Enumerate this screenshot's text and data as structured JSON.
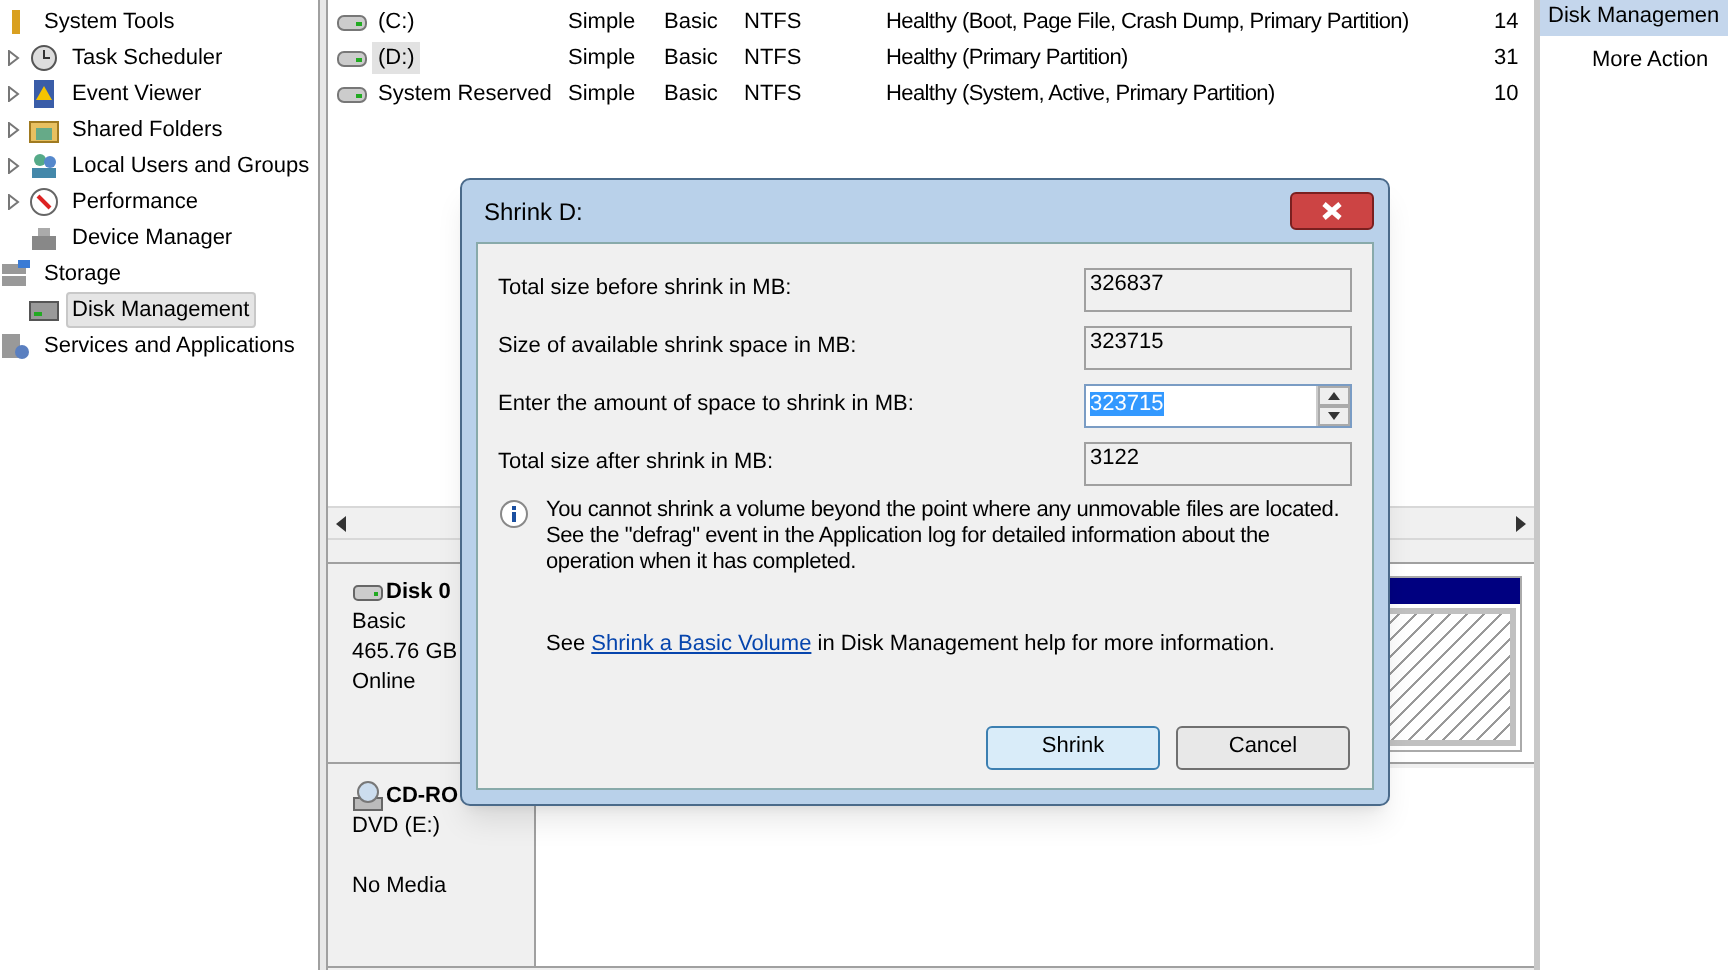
{
  "tree": [
    {
      "label": "System Tools",
      "selected": false,
      "children": [
        {
          "label": "Task Scheduler",
          "expandable": true,
          "selected": false
        },
        {
          "label": "Event Viewer",
          "expandable": true,
          "selected": false
        },
        {
          "label": "Shared Folders",
          "expandable": true,
          "selected": false
        },
        {
          "label": "Local Users and Groups",
          "expandable": true,
          "selected": false
        },
        {
          "label": "Performance",
          "expandable": true,
          "selected": false
        },
        {
          "label": "Device Manager",
          "expandable": false,
          "selected": false
        }
      ]
    },
    {
      "label": "Storage",
      "selected": false,
      "children": [
        {
          "label": "Disk Management",
          "expandable": false,
          "selected": true
        }
      ]
    },
    {
      "label": "Services and Applications",
      "selected": false
    }
  ],
  "volumes": [
    {
      "volume": "(C:)",
      "layout": "Simple",
      "type": "Basic",
      "file_system": "NTFS",
      "status": "Healthy (Boot, Page File, Crash Dump, Primary Partition)",
      "column_6": "14",
      "selected": false
    },
    {
      "volume": "(D:)",
      "layout": "Simple",
      "type": "Basic",
      "file_system": "NTFS",
      "status": "Healthy (Primary Partition)",
      "column_6": "31",
      "selected": true
    },
    {
      "volume": "System Reserved",
      "layout": "Simple",
      "type": "Basic",
      "file_system": "NTFS",
      "status": "Healthy (System, Active, Primary Partition)",
      "column_6": "10",
      "selected": false
    }
  ],
  "disks": [
    {
      "name": "Disk 0",
      "kind": "disk",
      "type": "Basic",
      "size": "465.76 GB",
      "status": "Online"
    },
    {
      "name": "CD-RO",
      "kind": "cdrom",
      "type": "DVD (E:)",
      "status": "No Media"
    }
  ],
  "actions": {
    "header": "Disk Managemen",
    "items": [
      "More Action"
    ]
  },
  "dialog": {
    "title": "Shrink D:",
    "fields": [
      {
        "label": "Total size before shrink in MB:",
        "value": "326837",
        "kind": "readonly"
      },
      {
        "label": "Size of available shrink space in MB:",
        "value": "323715",
        "kind": "readonly"
      },
      {
        "label": "Enter the amount of space to shrink in MB:",
        "value": "323715",
        "kind": "spin"
      },
      {
        "label": "Total size after shrink in MB:",
        "value": "3122",
        "kind": "readonly"
      }
    ],
    "note": "You cannot shrink a volume beyond the point where any unmovable files are located. See the \"defrag\" event in the Application log for detailed information about the operation when it has completed.",
    "help": {
      "before": "See",
      "link": "Shrink a Basic Volume",
      "after": "in Disk Management help for more information."
    },
    "buttons": [
      {
        "label": "Shrink",
        "default": true
      },
      {
        "label": "Cancel",
        "default": false
      }
    ]
  }
}
